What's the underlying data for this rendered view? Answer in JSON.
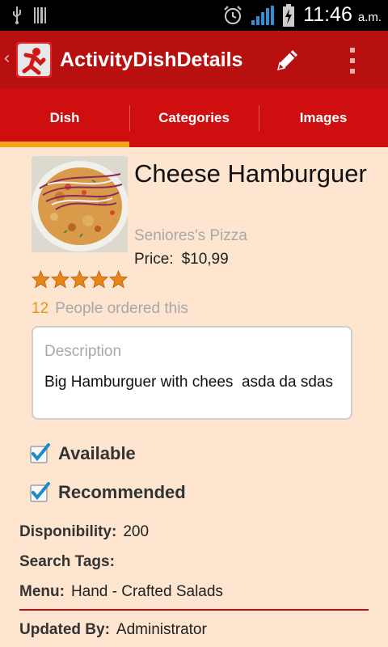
{
  "status_bar": {
    "time": "11:46",
    "ampm": "a.m.",
    "icons": [
      "usb-icon",
      "barcode-icon",
      "alarm-icon",
      "signal-icon",
      "battery-charging-icon"
    ]
  },
  "action_bar": {
    "title": "ActivityDishDetails",
    "icons": [
      "up-caret-icon",
      "app-logo-icon",
      "edit-pencil-icon",
      "overflow-menu-icon"
    ]
  },
  "tabs": [
    {
      "label": "Dish",
      "active": true
    },
    {
      "label": "Categories",
      "active": false
    },
    {
      "label": "Images",
      "active": false
    }
  ],
  "dish": {
    "name": "Cheese Hamburguer",
    "restaurant": "Seniores's Pizza",
    "price_label": "Price:",
    "price_value": "$10,99",
    "rating": 5,
    "rating_max": 5,
    "orders_count": "12",
    "orders_text": "People ordered this"
  },
  "description": {
    "label": "Description",
    "text": "Big Hamburguer with chees  asda da sdas"
  },
  "checkboxes": [
    {
      "label": "Available",
      "checked": true
    },
    {
      "label": "Recommended",
      "checked": true
    }
  ],
  "fields": {
    "disponibility": {
      "key": "Disponibility:",
      "value": "200"
    },
    "search_tags": {
      "key": "Search Tags:",
      "value": ""
    },
    "menu": {
      "key": "Menu:",
      "value": "Hand - Crafted Salads"
    },
    "updated_by": {
      "key": "Updated By:",
      "value": "Administrator"
    }
  },
  "colors": {
    "action_bar": "#b80f0f",
    "tabs": "#cf0f0f",
    "tab_indicator": "#f4a21b",
    "background": "#fde5cf",
    "star": "#e8861a"
  }
}
